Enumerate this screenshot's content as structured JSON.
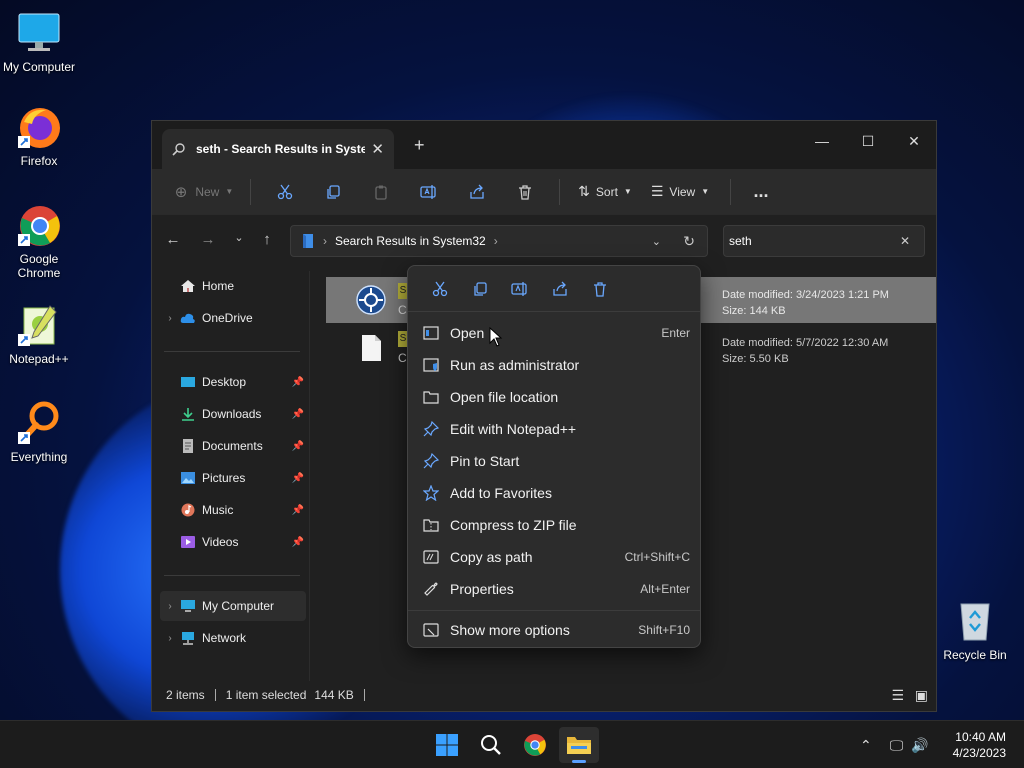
{
  "desktop": {
    "icons": [
      {
        "label": "My Computer"
      },
      {
        "label": "Firefox"
      },
      {
        "label": "Google Chrome"
      },
      {
        "label": "Notepad++"
      },
      {
        "label": "Everything"
      },
      {
        "label": "Recycle Bin"
      }
    ]
  },
  "window": {
    "tab_title": "seth - Search Results in Syster",
    "toolbar": {
      "new_label": "New",
      "sort_label": "Sort",
      "view_label": "View",
      "more_label": "..."
    },
    "address": {
      "path": "Search Results in System32"
    },
    "search": {
      "value": "seth"
    },
    "sidebar": {
      "items": [
        {
          "label": "Home"
        },
        {
          "label": "OneDrive"
        },
        {
          "label": "Desktop"
        },
        {
          "label": "Downloads"
        },
        {
          "label": "Documents"
        },
        {
          "label": "Pictures"
        },
        {
          "label": "Music"
        },
        {
          "label": "Videos"
        },
        {
          "label": "My Computer"
        },
        {
          "label": "Network"
        }
      ]
    },
    "files": [
      {
        "name_fragment": "S",
        "sub_fragment": "C",
        "date": "Date modified: 3/24/2023 1:21 PM",
        "size": "Size: 144 KB"
      },
      {
        "name_fragment": "S",
        "sub_fragment": "C",
        "date": "Date modified: 5/7/2022 12:30 AM",
        "size": "Size: 5.50 KB"
      }
    ],
    "status": {
      "items": "2 items",
      "selected": "1 item selected",
      "size": "144 KB"
    }
  },
  "context_menu": {
    "items": [
      {
        "label": "Open",
        "shortcut": "Enter"
      },
      {
        "label": "Run as administrator",
        "shortcut": ""
      },
      {
        "label": "Open file location",
        "shortcut": ""
      },
      {
        "label": "Edit with Notepad++",
        "shortcut": ""
      },
      {
        "label": "Pin to Start",
        "shortcut": ""
      },
      {
        "label": "Add to Favorites",
        "shortcut": ""
      },
      {
        "label": "Compress to ZIP file",
        "shortcut": ""
      },
      {
        "label": "Copy as path",
        "shortcut": "Ctrl+Shift+C"
      },
      {
        "label": "Properties",
        "shortcut": "Alt+Enter"
      },
      {
        "label": "Show more options",
        "shortcut": "Shift+F10"
      }
    ]
  },
  "taskbar": {
    "clock_time": "10:40 AM",
    "clock_date": "4/23/2023"
  },
  "colors": {
    "accent": "#5aa0ff",
    "selection": "#777777",
    "folder": "#e8b73a"
  }
}
